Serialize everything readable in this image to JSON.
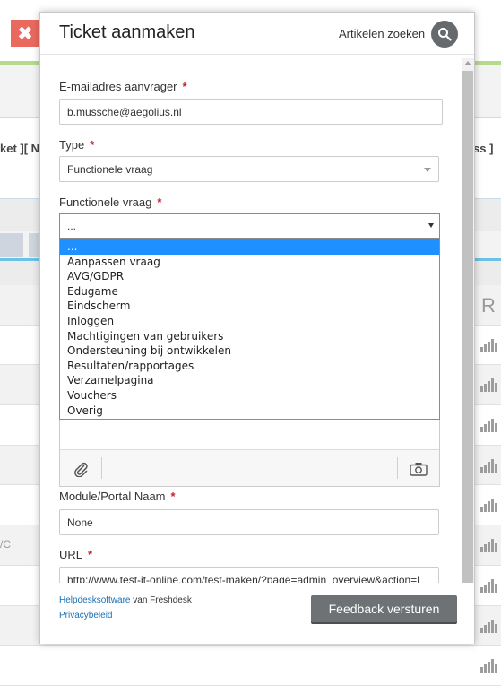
{
  "background": {
    "left_text": "ket ][ N",
    "right_text": "ss ]",
    "column_header": "R",
    "row_fragment": "/C",
    "close_symbol": "✖"
  },
  "modal": {
    "title": "Ticket aanmaken",
    "search_link": "Artikelen zoeken",
    "required_mark": "*",
    "email": {
      "label": "E-mailadres aanvrager",
      "value": "b.mussche@aegolius.nl"
    },
    "type": {
      "label": "Type",
      "value": "Functionele vraag"
    },
    "functionele_vraag": {
      "label": "Functionele vraag",
      "value": "...",
      "options": [
        "...",
        "Aanpassen vraag",
        "AVG/GDPR",
        "Edugame",
        "Eindscherm",
        "Inloggen",
        "Machtigingen van gebruikers",
        "Ondersteuning bij ontwikkelen",
        "Resultaten/rapportages",
        "Verzamelpagina",
        "Vouchers",
        "Overig"
      ],
      "selected_index": 0
    },
    "module": {
      "label": "Module/Portal Naam",
      "value": "None"
    },
    "url": {
      "label": "URL",
      "value": "http://www.test-it-online.com/test-maken/?page=admin_overview&action=l"
    },
    "footer": {
      "helpdesk_link": "Helpdesksoftware",
      "helpdesk_suffix": " van Freshdesk",
      "privacy_link": "Privacybeleid",
      "feedback_button": "Feedback versturen"
    }
  },
  "colors": {
    "accent_required": "#c8232c",
    "dropdown_selected": "#1e90ff",
    "button_bg": "#6f7274",
    "link": "#1a6fb5"
  }
}
